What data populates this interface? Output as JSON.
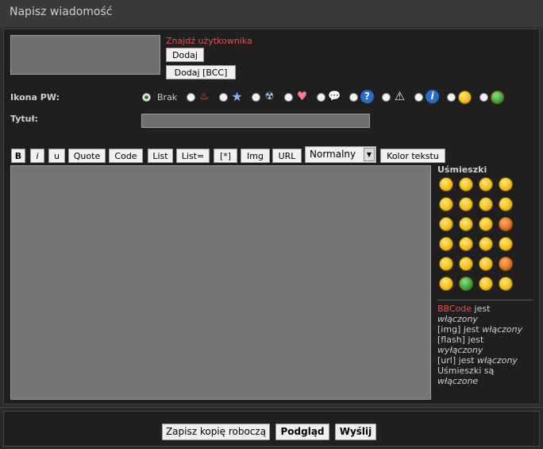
{
  "header": {
    "title": "Napisz wiadomość"
  },
  "recipients": {
    "find_user": "Znajdź użytkownika",
    "add": "Dodaj",
    "add_bcc": "Dodaj [BCC]"
  },
  "icon_row": {
    "label": "Ikona PW:",
    "none_label": "Brak",
    "icons": [
      "fire-icon",
      "star-icon",
      "radioactive-icon",
      "heart-icon",
      "speech-bubble-icon",
      "question-icon",
      "warning-icon",
      "info-icon",
      "idea-face-icon",
      "alien-icon"
    ],
    "selected": "Brak"
  },
  "title_row": {
    "label": "Tytuł:",
    "value": ""
  },
  "toolbar": {
    "b": "B",
    "i": "i",
    "u": "u",
    "quote": "Quote",
    "code": "Code",
    "list": "List",
    "list_eq": "List=",
    "star": "[*]",
    "img": "Img",
    "url": "URL",
    "font_size": "Normalny",
    "color": "Kolor tekstu"
  },
  "smilies": {
    "title": "Uśmieszki",
    "items": [
      "😁",
      "😄",
      "😉",
      "😑",
      "😮",
      "😵",
      "😕",
      "😎",
      "😀",
      "😖",
      "😊",
      "😡",
      "😐",
      "😠",
      "😝",
      "😜",
      "!",
      "?",
      "💡",
      "➜",
      "🙂",
      "😬",
      "🤓",
      "🤪"
    ]
  },
  "info": {
    "bbcode_link": "BBCode",
    "bbcode_rest": " jest ",
    "bbcode_state": "włączony",
    "img_text": "[img] jest ",
    "img_state": "włączony",
    "flash_text": "[flash] jest ",
    "flash_state": "wyłączony",
    "url_text": "[url] jest ",
    "url_state": "włączony",
    "smilies_text": "Uśmieszki są ",
    "smilies_state": "włączone"
  },
  "footer": {
    "save_draft": "Zapisz kopię roboczą",
    "preview": "Podgląd",
    "send": "Wyślij"
  },
  "colors": {
    "accent_red": "#e05050",
    "bg_dark": "#1f1f1f",
    "field_gray": "#707070"
  }
}
